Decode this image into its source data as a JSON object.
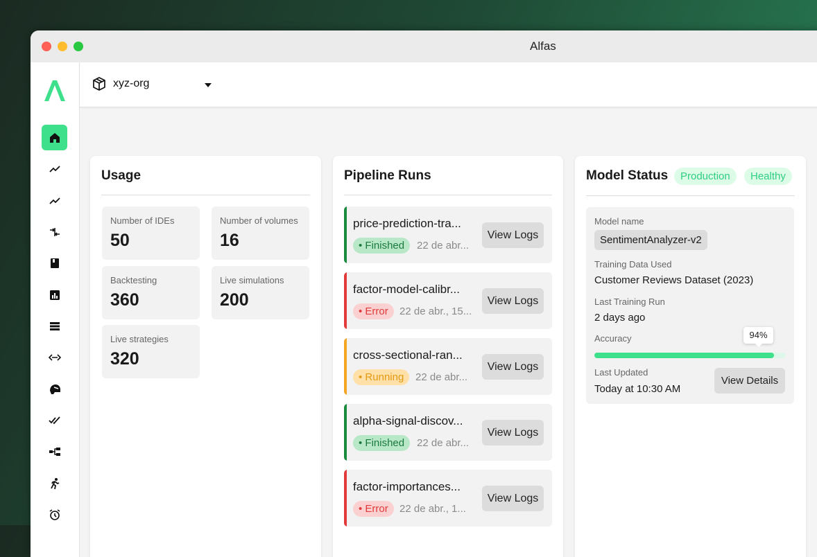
{
  "window": {
    "title": "Alfas"
  },
  "org": {
    "name": "xyz-org"
  },
  "sidebar": {
    "items": [
      {
        "icon": "home-icon",
        "active": true
      },
      {
        "icon": "trend-line-icon"
      },
      {
        "icon": "trend-line-icon"
      },
      {
        "icon": "merge-arrows-icon"
      },
      {
        "icon": "book-icon"
      },
      {
        "icon": "bar-chart-icon"
      },
      {
        "icon": "list-icon"
      },
      {
        "icon": "code-arrows-icon"
      },
      {
        "icon": "helmet-icon"
      },
      {
        "icon": "double-check-icon"
      },
      {
        "icon": "hierarchy-icon"
      },
      {
        "icon": "runner-icon"
      },
      {
        "icon": "alarm-icon"
      }
    ]
  },
  "usage": {
    "title": "Usage",
    "stats": [
      {
        "label": "Number of IDEs",
        "value": "50"
      },
      {
        "label": "Number of volumes",
        "value": "16"
      },
      {
        "label": "Backtesting",
        "value": "360"
      },
      {
        "label": "Live simulations",
        "value": "200"
      },
      {
        "label": "Live strategies",
        "value": "320"
      }
    ]
  },
  "pipeline": {
    "title": "Pipeline Runs",
    "button_label": "View Logs",
    "runs": [
      {
        "name": "price-prediction-tra...",
        "status": "Finished",
        "date": "22 de abr...",
        "status_color": "#1a8a3e"
      },
      {
        "name": "factor-model-calibr...",
        "status": "Error",
        "date": "22 de abr., 15...",
        "status_color": "#e23a3a"
      },
      {
        "name": "cross-sectional-ran...",
        "status": "Running",
        "date": "22 de abr...",
        "status_color": "#f5a623"
      },
      {
        "name": "alpha-signal-discov...",
        "status": "Finished",
        "date": "22 de abr...",
        "status_color": "#1a8a3e"
      },
      {
        "name": "factor-importances...",
        "status": "Error",
        "date": "22 de abr., 1...",
        "status_color": "#e23a3a"
      }
    ]
  },
  "model": {
    "title": "Model Status",
    "badges": [
      "Production",
      "Healthy"
    ],
    "name_label": "Model name",
    "name_value": "SentimentAnalyzer-v2",
    "data_label": "Training Data Used",
    "data_value": "Customer Reviews Dataset (2023)",
    "run_label": "Last Training Run",
    "run_value": "2 days ago",
    "accuracy_label": "Accuracy",
    "accuracy_value": "94%",
    "accuracy_fraction": 0.94,
    "updated_label": "Last Updated",
    "updated_value": "Today at 10:30 AM",
    "details_label": "View Details"
  },
  "colors": {
    "accent": "#3ee08c"
  }
}
